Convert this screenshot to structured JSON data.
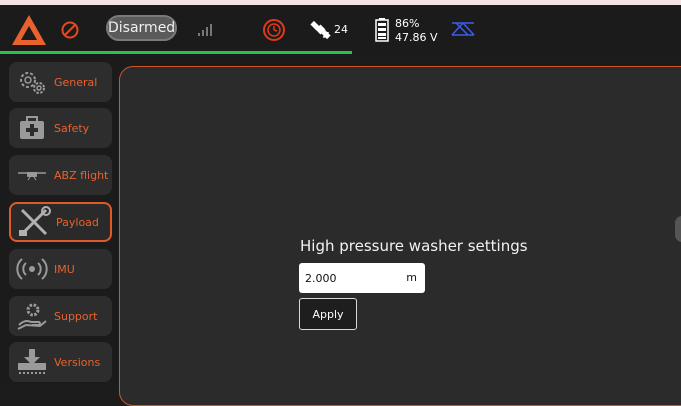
{
  "toolbar": {
    "status": "Disarmed",
    "satellites": "24",
    "battery_percent": "86%",
    "battery_voltage": "47.86 V"
  },
  "colors": {
    "accent": "#e8622e",
    "gps_ok": "#2ec04e",
    "rc_icon": "#3a5cf0"
  },
  "sidebar": {
    "items": [
      {
        "label": "General",
        "icon": "gears-icon"
      },
      {
        "label": "Safety",
        "icon": "first-aid-kit-icon"
      },
      {
        "label": "ABZ flight",
        "icon": "drone-icon"
      },
      {
        "label": "Payload",
        "icon": "tools-icon",
        "active": true
      },
      {
        "label": "IMU",
        "icon": "radio-waves-icon"
      },
      {
        "label": "Support",
        "icon": "support-hand-icon"
      },
      {
        "label": "Versions",
        "icon": "download-icon"
      }
    ]
  },
  "main": {
    "section_title": "High pressure washer settings",
    "field_value": "2.000",
    "field_unit": "m",
    "apply_label": "Apply"
  }
}
